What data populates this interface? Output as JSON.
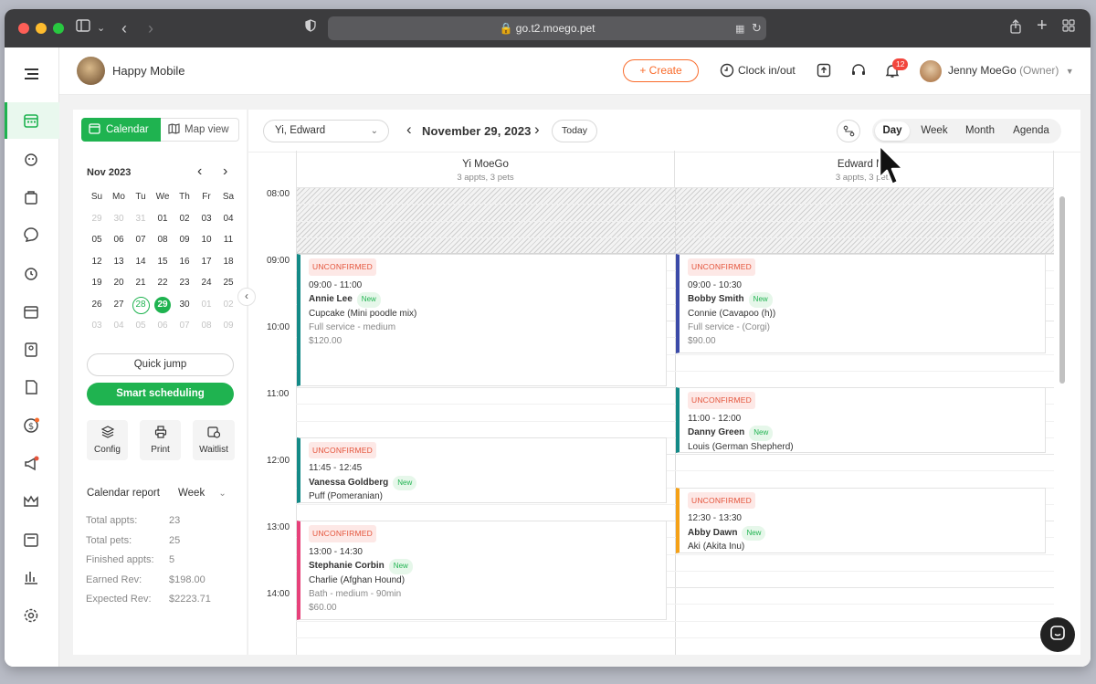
{
  "browser": {
    "url": "go.t2.moego.pet"
  },
  "business": {
    "name": "Happy Mobile"
  },
  "topbar": {
    "create": "+ Create",
    "clock": "Clock in/out",
    "notif_count": "12",
    "user": "Jenny MoeGo",
    "role": "(Owner)"
  },
  "panel": {
    "tab_calendar": "Calendar",
    "tab_map": "Map view",
    "month": "Nov 2023",
    "weekdays": [
      "Su",
      "Mo",
      "Tu",
      "We",
      "Th",
      "Fr",
      "Sa"
    ],
    "weeks": [
      [
        "29",
        "30",
        "31",
        "01",
        "02",
        "03",
        "04"
      ],
      [
        "05",
        "06",
        "07",
        "08",
        "09",
        "10",
        "11"
      ],
      [
        "12",
        "13",
        "14",
        "15",
        "16",
        "17",
        "18"
      ],
      [
        "19",
        "20",
        "21",
        "22",
        "23",
        "24",
        "25"
      ],
      [
        "26",
        "27",
        "28",
        "29",
        "30",
        "01",
        "02"
      ],
      [
        "03",
        "04",
        "05",
        "06",
        "07",
        "08",
        "09"
      ]
    ],
    "quick_jump": "Quick jump",
    "smart": "Smart scheduling",
    "tools": [
      {
        "label": "Config"
      },
      {
        "label": "Print"
      },
      {
        "label": "Waitlist"
      }
    ],
    "report_label": "Calendar report",
    "report_period": "Week",
    "stats": [
      {
        "k": "Total appts:",
        "v": "23"
      },
      {
        "k": "Total pets:",
        "v": "25"
      },
      {
        "k": "Finished appts:",
        "v": "5"
      },
      {
        "k": "Earned Rev:",
        "v": "$198.00"
      },
      {
        "k": "Expected Rev:",
        "v": "$2223.71"
      }
    ]
  },
  "calendar": {
    "staff_filter": "Yi, Edward",
    "date": "November 29, 2023",
    "today": "Today",
    "views": [
      "Day",
      "Week",
      "Month",
      "Agenda"
    ],
    "columns": [
      {
        "name": "Yi MoeGo",
        "info": "3 appts, 3 pets"
      },
      {
        "name": "Edward Mo",
        "info": "3 appts, 3 pets"
      }
    ],
    "hours": [
      "08:00",
      "09:00",
      "10:00",
      "11:00",
      "12:00",
      "13:00",
      "14:00"
    ],
    "appts": [
      {
        "status": "UNCONFIRMED",
        "time": "09:00 - 11:00",
        "client": "Annie Lee",
        "tag": "New",
        "pet": "Cupcake",
        "breed": "(Mini poodle mix)",
        "service": "Full service - medium",
        "price": "$120.00",
        "color": "#138a87"
      },
      {
        "status": "UNCONFIRMED",
        "time": "11:45 - 12:45",
        "client": "Vanessa Goldberg",
        "tag": "New",
        "pet": "Puff",
        "breed": "(Pomeranian)",
        "service": "",
        "price": "",
        "color": "#138a87"
      },
      {
        "status": "UNCONFIRMED",
        "time": "13:00 - 14:30",
        "client": "Stephanie Corbin",
        "tag": "New",
        "pet": "Charlie",
        "breed": "(Afghan Hound)",
        "service": "Bath - medium - 90min",
        "price": "$60.00",
        "color": "#e7417a"
      },
      {
        "status": "UNCONFIRMED",
        "time": "09:00 - 10:30",
        "client": "Bobby Smith",
        "tag": "New",
        "pet": "Connie",
        "breed": "(Cavapoo (h))",
        "service": "Full service - (Corgi)",
        "price": "$90.00",
        "color": "#3b4aa8"
      },
      {
        "status": "UNCONFIRMED",
        "time": "11:00 - 12:00",
        "client": "Danny Green",
        "tag": "New",
        "pet": "Louis",
        "breed": "(German Shepherd)",
        "service": "",
        "price": "",
        "color": "#138a87"
      },
      {
        "status": "UNCONFIRMED",
        "time": "12:30 - 13:30",
        "client": "Abby Dawn",
        "tag": "New",
        "pet": "Aki",
        "breed": "(Akita Inu)",
        "service": "",
        "price": "",
        "color": "#f5a117"
      }
    ]
  },
  "colors": {
    "accent": "#1fb350",
    "orange": "#f96b2b",
    "red_badge": "#e4543b"
  }
}
